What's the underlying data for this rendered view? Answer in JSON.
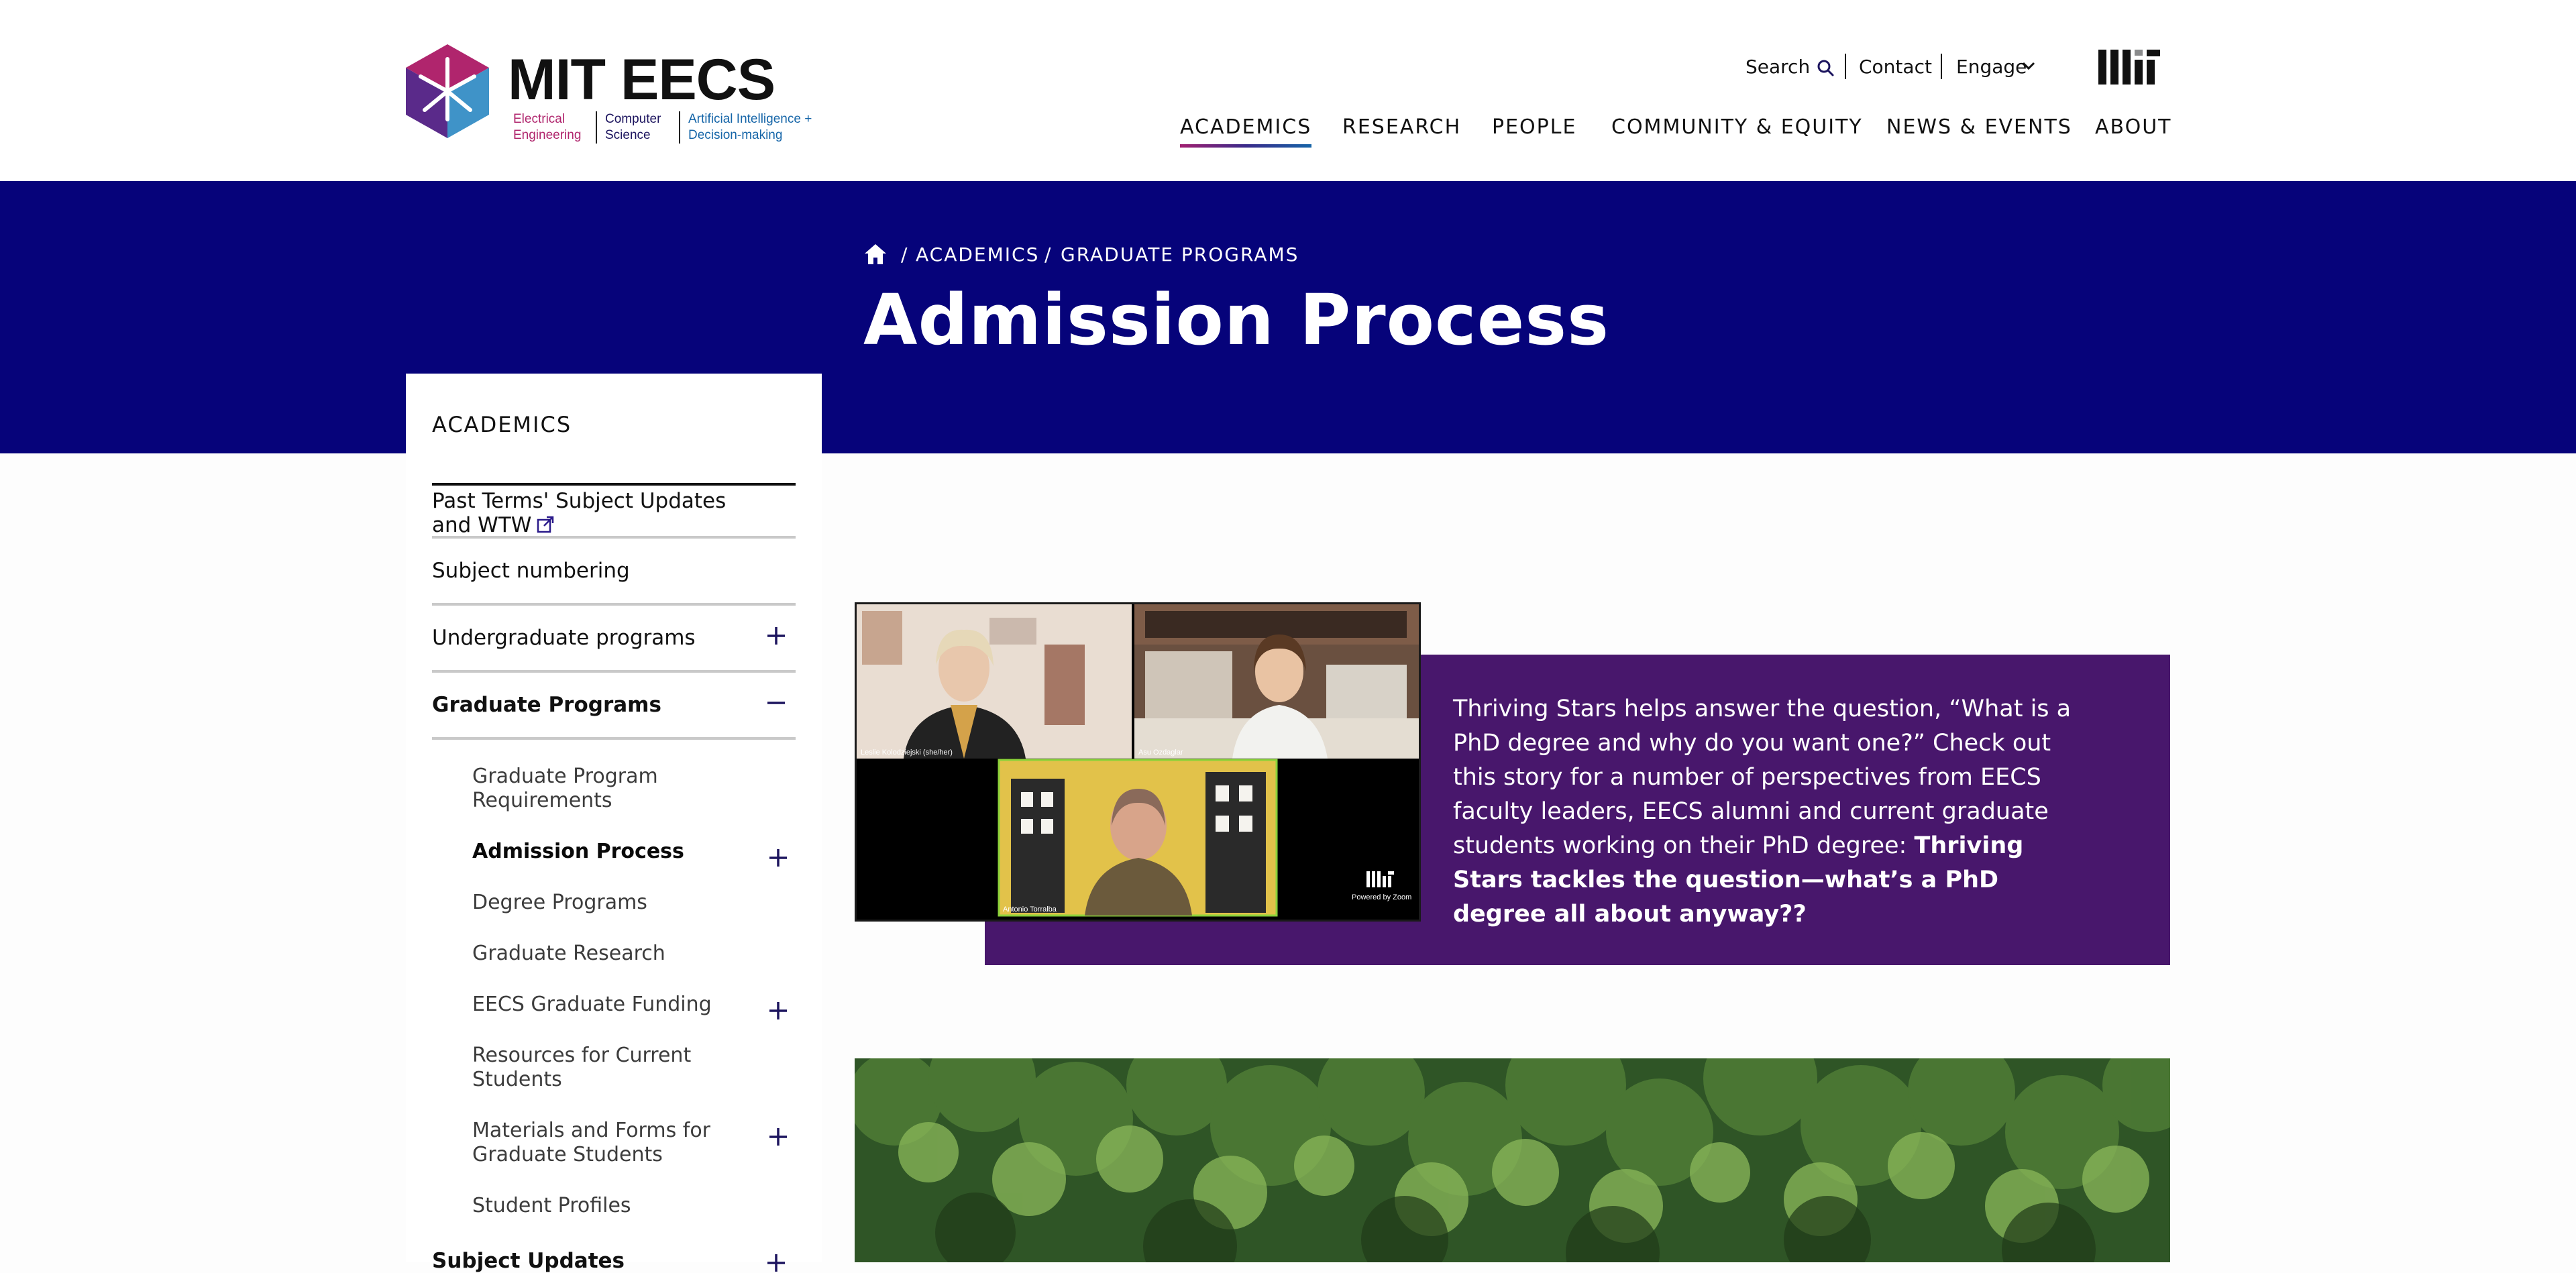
{
  "brand": {
    "wordmark": "MIT EECS",
    "sub_ee": "Electrical Engineering",
    "sub_cs": "Computer Science",
    "sub_ai": "Artificial Intelligence + Decision-making",
    "colors": {
      "magenta": "#a31f70",
      "navy": "#06037a",
      "purple": "#48176c",
      "blue": "#1565a8"
    }
  },
  "utility": {
    "search": "Search",
    "contact": "Contact",
    "engage": "Engage"
  },
  "nav": {
    "academics": "ACADEMICS",
    "research": "RESEARCH",
    "people": "PEOPLE",
    "community": "COMMUNITY & EQUITY",
    "news": "NEWS & EVENTS",
    "about": "ABOUT"
  },
  "breadcrumb": {
    "home_icon": "home-icon",
    "sep": "/",
    "academics": "ACADEMICS",
    "grad": "GRADUATE PROGRAMS"
  },
  "page_title": "Admission Process",
  "sidebar": {
    "heading": "ACADEMICS",
    "items": [
      {
        "label": "Past Terms' Subject Updates and WTW",
        "icon": "external-link-icon"
      },
      {
        "label": "Subject numbering"
      },
      {
        "label": "Undergraduate programs",
        "icon": "plus-icon"
      },
      {
        "label": "Graduate Programs",
        "icon": "minus-icon"
      }
    ],
    "sub": [
      {
        "label": "Graduate Program Requirements"
      },
      {
        "label": "Admission Process",
        "icon": "plus-icon"
      },
      {
        "label": "Degree Programs"
      },
      {
        "label": "Graduate Research"
      },
      {
        "label": "EECS Graduate Funding",
        "icon": "plus-icon"
      },
      {
        "label": "Resources for Current Students"
      },
      {
        "label": "Materials and Forms for Graduate Students",
        "icon": "plus-icon"
      },
      {
        "label": "Student Profiles"
      }
    ],
    "next_item": "Subject Updates"
  },
  "story": {
    "text": "Thriving Stars helps answer the question, “What is a PhD degree and why do you want one?” Check out this story for a number of perspectives from EECS faculty leaders, EECS alumni and current graduate students working on their PhD degree:",
    "link": "Thriving Stars tackles the question—what’s a PhD degree all about anyway??",
    "photo": {
      "caption_1": "Leslie Kolodziejski (she/her)",
      "caption_2": "Asu Ozdaglar",
      "caption_3": "Antonio Torralba",
      "powered": "Powered by Zoom"
    }
  }
}
